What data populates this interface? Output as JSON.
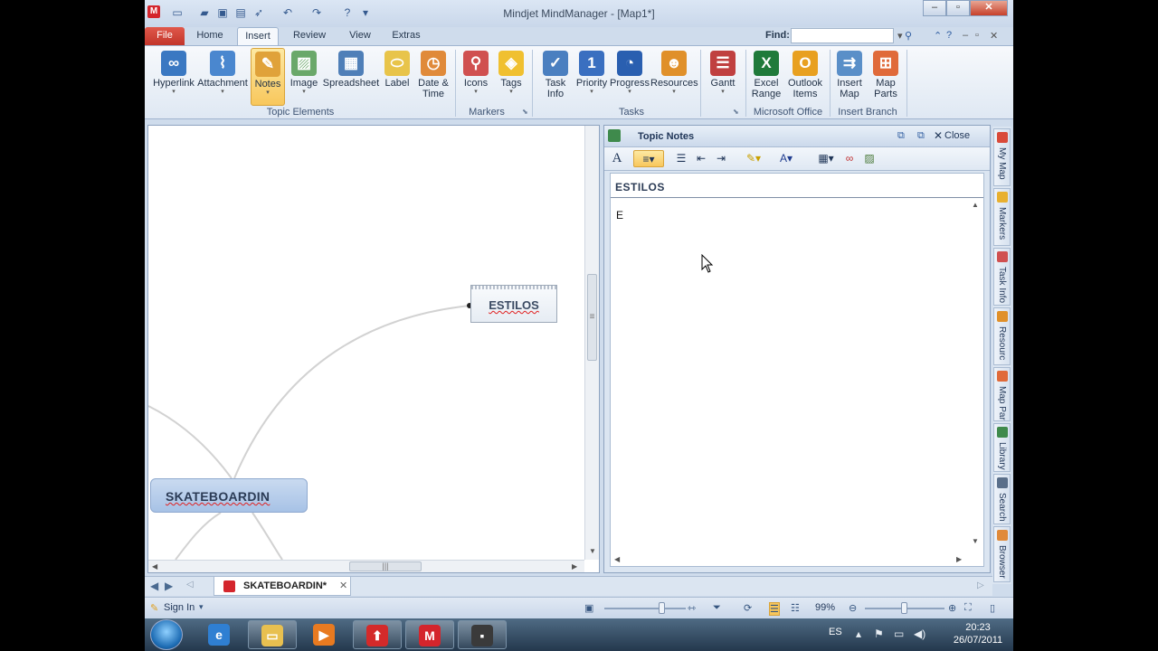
{
  "window": {
    "title": "Mindjet MindManager - [Map1*]",
    "app_icon": "M"
  },
  "tabs": [
    "File",
    "Home",
    "Insert",
    "Review",
    "View",
    "Extras"
  ],
  "find": {
    "label": "Find:",
    "value": ""
  },
  "ribbon": {
    "topic_elements": {
      "label": "Topic Elements",
      "buttons": [
        {
          "label": "Hyperlink",
          "icon": "hyperlink-icon",
          "color": "#3a78c2"
        },
        {
          "label": "Attachment",
          "icon": "paperclip-icon",
          "color": "#4a87cf"
        },
        {
          "label": "Notes",
          "icon": "notes-icon",
          "color": "#e0a23a"
        },
        {
          "label": "Image",
          "icon": "image-icon",
          "color": "#6aa86a"
        },
        {
          "label": "Spreadsheet",
          "icon": "spreadsheet-icon",
          "color": "#4f7fb8"
        },
        {
          "label": "Label",
          "icon": "label-icon",
          "color": "#e8c44a"
        },
        {
          "label1": "Date &",
          "label2": "Time",
          "icon": "calendar-clock-icon",
          "color": "#e08a3a"
        }
      ]
    },
    "markers": {
      "label": "Markers",
      "buttons": [
        {
          "label": "Icons",
          "icon": "pushpin-icon",
          "color": "#d05050"
        },
        {
          "label": "Tags",
          "icon": "tags-icon",
          "color": "#f0c030"
        }
      ]
    },
    "tasks": {
      "label": "Tasks",
      "buttons": [
        {
          "label1": "Task",
          "label2": "Info",
          "icon": "task-info-icon",
          "color": "#4a7fc0"
        },
        {
          "label": "Priority",
          "icon": "priority-icon",
          "color": "#3a6fc0"
        },
        {
          "label": "Progress",
          "icon": "progress-icon",
          "color": "#2a5fb0"
        },
        {
          "label": "Resources",
          "icon": "resources-icon",
          "color": "#e0902a"
        }
      ]
    },
    "gantt": {
      "label": "Gantt",
      "icon": "gantt-icon",
      "color": "#c04040"
    },
    "microsoft_office": {
      "label": "Microsoft Office",
      "buttons": [
        {
          "label1": "Excel",
          "label2": "Range",
          "icon": "excel-icon",
          "color": "#1f7a3a"
        },
        {
          "label1": "Outlook",
          "label2": "Items",
          "icon": "outlook-icon",
          "color": "#e8a020"
        }
      ]
    },
    "insert_branch": {
      "label": "Insert Branch",
      "buttons": [
        {
          "label1": "Insert",
          "label2": "Map",
          "icon": "insert-map-icon",
          "color": "#5a8fc8"
        },
        {
          "label1": "Map",
          "label2": "Parts",
          "icon": "map-parts-icon",
          "color": "#e06a3a"
        }
      ]
    }
  },
  "map": {
    "central_topic": "SKATEBOARDIN",
    "subtopic": "ESTILOS"
  },
  "notes": {
    "title": "Topic Notes",
    "close_label": "Close",
    "topic_heading": "ESTILOS",
    "body_text": "E"
  },
  "side_tabs": [
    "My Map",
    "Markers",
    "Task Info",
    "Resourc",
    "Map Par",
    "Library",
    "Search",
    "Browser"
  ],
  "doc_tab": {
    "label": "SKATEBOARDIN*"
  },
  "status": {
    "signin": "Sign In",
    "zoom": "99%"
  },
  "taskbar": {
    "lang": "ES",
    "time": "20:23",
    "date": "26/07/2011"
  }
}
